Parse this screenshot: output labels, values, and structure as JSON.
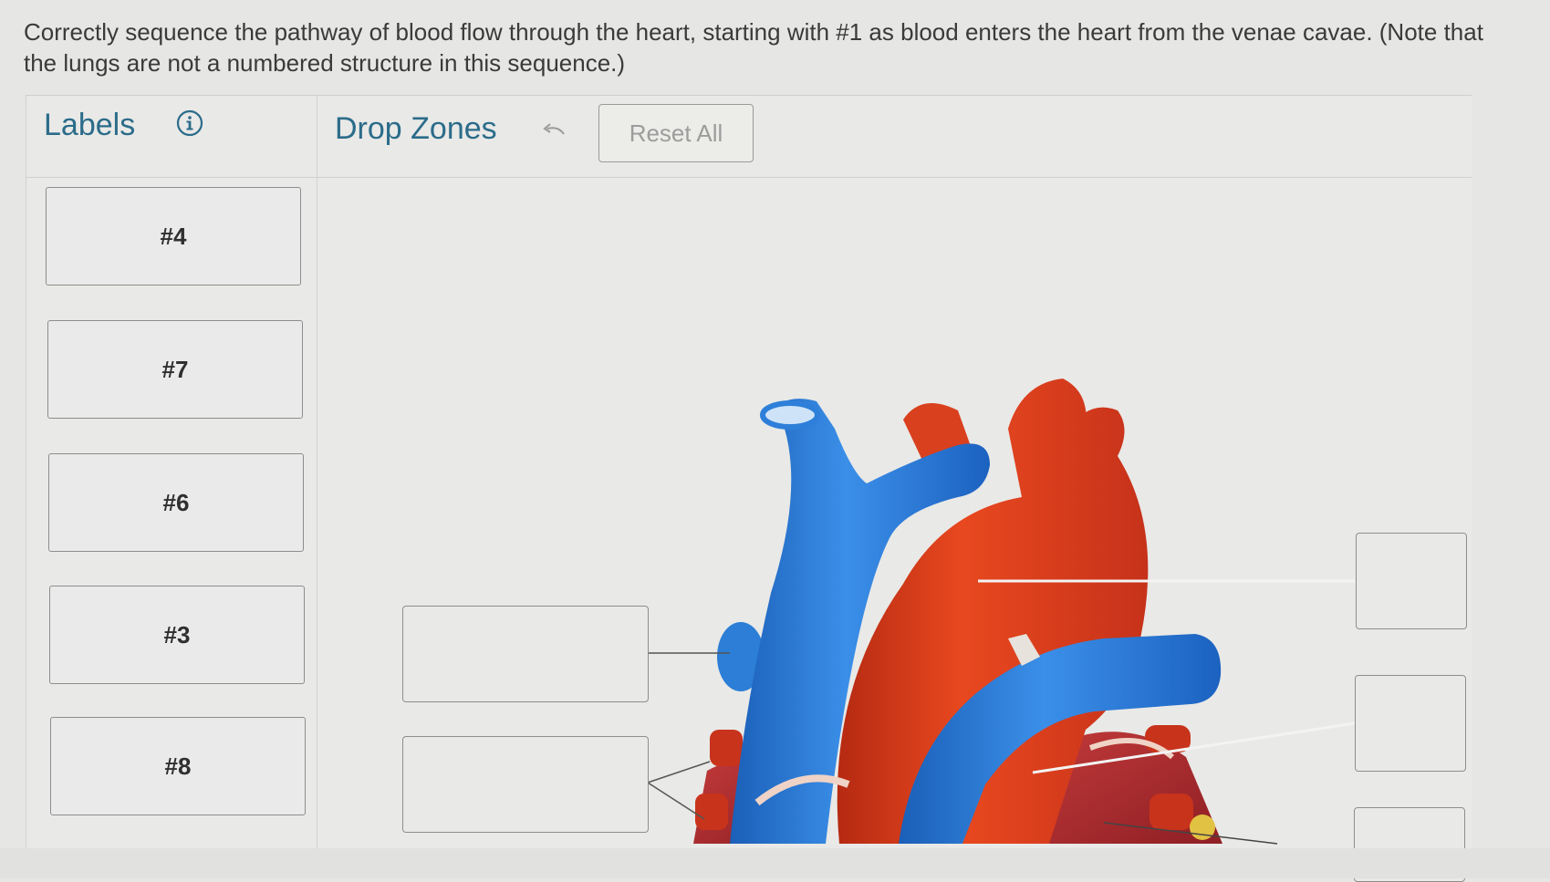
{
  "question": {
    "text": "Correctly sequence the pathway of blood flow through the heart, starting with #1 as blood enters the heart from the venae cavae. (Note that the lungs are not a numbered structure in this sequence.)"
  },
  "labels_panel": {
    "title": "Labels",
    "info_icon": "info-icon",
    "cards": [
      {
        "text": "#4"
      },
      {
        "text": "#7"
      },
      {
        "text": "#6"
      },
      {
        "text": "#3"
      },
      {
        "text": "#8"
      }
    ]
  },
  "drop_zones_panel": {
    "title": "Drop Zones",
    "undo_icon": "undo-arrow-icon",
    "reset_label": "Reset All"
  },
  "colors": {
    "title_blue": "#2b6c8a",
    "vein_blue": "#2d7fd9",
    "artery_red": "#d63a1e"
  }
}
